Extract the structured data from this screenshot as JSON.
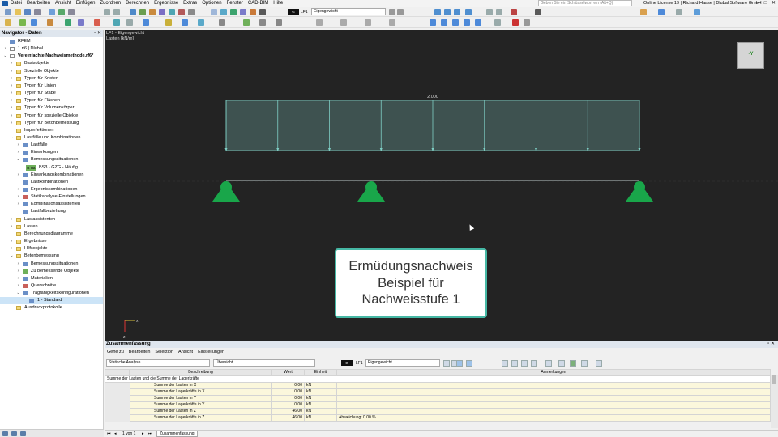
{
  "menu": {
    "items": [
      "Datei",
      "Bearbeiten",
      "Ansicht",
      "Einfügen",
      "Zuordnen",
      "Berechnen",
      "Ergebnisse",
      "Extras",
      "Optionen",
      "Fenster",
      "CAD-BIM",
      "Hilfe"
    ],
    "search_placeholder": "Geben Sie ein Schlüsselwort ein (Alt+Q)",
    "license": "Online License 19 | Richard Haase | Dlubal Software GmbH"
  },
  "toolbar": {
    "lc_badge": "G",
    "lc_code": "LF1",
    "lc_name": "Eigengewicht"
  },
  "navigator": {
    "title": "Navigator - Daten",
    "items": [
      {
        "label": "RFEM",
        "indent": 0,
        "arrow": "",
        "icon": "app"
      },
      {
        "label": "1.rf6 | Dlubal",
        "indent": 0,
        "arrow": "›",
        "icon": "doc"
      },
      {
        "label": "Vereinfachte Nachweismethode.rf6*",
        "indent": 0,
        "arrow": "⌄",
        "icon": "doc",
        "bold": true
      },
      {
        "label": "Basisobjekte",
        "indent": 1,
        "arrow": "›",
        "icon": "fold"
      },
      {
        "label": "Spezielle Objekte",
        "indent": 1,
        "arrow": "›",
        "icon": "fold"
      },
      {
        "label": "Typen für Knoten",
        "indent": 1,
        "arrow": "›",
        "icon": "fold"
      },
      {
        "label": "Typen für Linien",
        "indent": 1,
        "arrow": "›",
        "icon": "fold"
      },
      {
        "label": "Typen für Stäbe",
        "indent": 1,
        "arrow": "›",
        "icon": "fold"
      },
      {
        "label": "Typen für Flächen",
        "indent": 1,
        "arrow": "›",
        "icon": "fold"
      },
      {
        "label": "Typen für Volumenkörper",
        "indent": 1,
        "arrow": "›",
        "icon": "fold"
      },
      {
        "label": "Typen für spezielle Objekte",
        "indent": 1,
        "arrow": "›",
        "icon": "fold"
      },
      {
        "label": "Typen für Betonbemessung",
        "indent": 1,
        "arrow": "›",
        "icon": "fold"
      },
      {
        "label": "Imperfektionen",
        "indent": 1,
        "arrow": "",
        "icon": "fold"
      },
      {
        "label": "Lastfälle und Kombinationen",
        "indent": 1,
        "arrow": "⌄",
        "icon": "fold"
      },
      {
        "label": "Lastfälle",
        "indent": 2,
        "arrow": "›",
        "icon": "b"
      },
      {
        "label": "Einwirkungen",
        "indent": 2,
        "arrow": "›",
        "icon": "b"
      },
      {
        "label": "Bemessungssituationen",
        "indent": 2,
        "arrow": "⌄",
        "icon": "b"
      },
      {
        "label": "BS3 - GZG - Häufig",
        "indent": 3,
        "arrow": "",
        "icon": "tag",
        "tag": "G Hä"
      },
      {
        "label": "Einwirkungskombinationen",
        "indent": 2,
        "arrow": "›",
        "icon": "b"
      },
      {
        "label": "Lastkombinationen",
        "indent": 2,
        "arrow": "",
        "icon": "b"
      },
      {
        "label": "Ergebniskombinationen",
        "indent": 2,
        "arrow": "›",
        "icon": "b"
      },
      {
        "label": "Statikanalyse-Einstellungen",
        "indent": 2,
        "arrow": "›",
        "icon": "r"
      },
      {
        "label": "Kombinationsassistenten",
        "indent": 2,
        "arrow": "›",
        "icon": "b"
      },
      {
        "label": "Lastfallbeziehung",
        "indent": 2,
        "arrow": "",
        "icon": "b"
      },
      {
        "label": "Lastassistenten",
        "indent": 1,
        "arrow": "›",
        "icon": "fold"
      },
      {
        "label": "Lasten",
        "indent": 1,
        "arrow": "›",
        "icon": "fold"
      },
      {
        "label": "Berechnungsdiagramme",
        "indent": 1,
        "arrow": "",
        "icon": "fold"
      },
      {
        "label": "Ergebnisse",
        "indent": 1,
        "arrow": "›",
        "icon": "fold"
      },
      {
        "label": "Hilfsobjekte",
        "indent": 1,
        "arrow": "›",
        "icon": "fold"
      },
      {
        "label": "Betonbemessung",
        "indent": 1,
        "arrow": "⌄",
        "icon": "fold"
      },
      {
        "label": "Bemessungssituationen",
        "indent": 2,
        "arrow": "›",
        "icon": "b"
      },
      {
        "label": "Zu bemessende Objekte",
        "indent": 2,
        "arrow": "›",
        "icon": "g"
      },
      {
        "label": "Materialien",
        "indent": 2,
        "arrow": "›",
        "icon": "b"
      },
      {
        "label": "Querschnitte",
        "indent": 2,
        "arrow": "›",
        "icon": "r"
      },
      {
        "label": "Tragfähigkeitskonfigurationen",
        "indent": 2,
        "arrow": "⌄",
        "icon": "b"
      },
      {
        "label": "1 - Standard",
        "indent": 3,
        "arrow": "",
        "icon": "b",
        "selected": true
      },
      {
        "label": "Ausdruckprotokolle",
        "indent": 1,
        "arrow": "",
        "icon": "fold"
      }
    ]
  },
  "view": {
    "title_line1": "LF1 - Eigengewicht",
    "title_line2": "Lasten [kN/m]",
    "load_value": "2.000",
    "view_cube_label": "-Y",
    "axis_x": "x",
    "axis_z": "z",
    "colors": {
      "load": "#7fcfc5",
      "support": "#19a64a",
      "background": "#232323"
    }
  },
  "callout": {
    "line1": "Ermüdungsnachweis",
    "line2": "Beispiel für",
    "line3": "Nachweisstufe 1"
  },
  "summary": {
    "title": "Zusammenfassung",
    "menu": [
      "Gehe zu",
      "Bearbeiten",
      "Selektion",
      "Ansicht",
      "Einstellungen"
    ],
    "analysis_select": "Statische Analyse",
    "overview_select": "Übersicht",
    "lc_badge": "G",
    "lc_code": "LF1",
    "lc_name": "Eigengewicht",
    "columns": [
      "Beschreibung",
      "Wert",
      "Einheit",
      "Anmerkungen"
    ],
    "group": "Summe der Lasten und die Summe der Lagerkräfte",
    "rows": [
      {
        "desc": "Summe der Lasten in X",
        "value": "0.00",
        "unit": "kN",
        "note": ""
      },
      {
        "desc": "Summe der Lagerkräfte in X",
        "value": "0.00",
        "unit": "kN",
        "note": ""
      },
      {
        "desc": "Summe der Lasten in Y",
        "value": "0.00",
        "unit": "kN",
        "note": ""
      },
      {
        "desc": "Summe der Lagerkräfte in Y",
        "value": "0.00",
        "unit": "kN",
        "note": ""
      },
      {
        "desc": "Summe der Lasten in Z",
        "value": "46.00",
        "unit": "kN",
        "note": ""
      },
      {
        "desc": "Summe der Lagerkräfte in Z",
        "value": "46.00",
        "unit": "kN",
        "note": "Abweichung: 0.00 %"
      }
    ],
    "pager": "1 von 1",
    "tab": "Zusammenfassung"
  }
}
